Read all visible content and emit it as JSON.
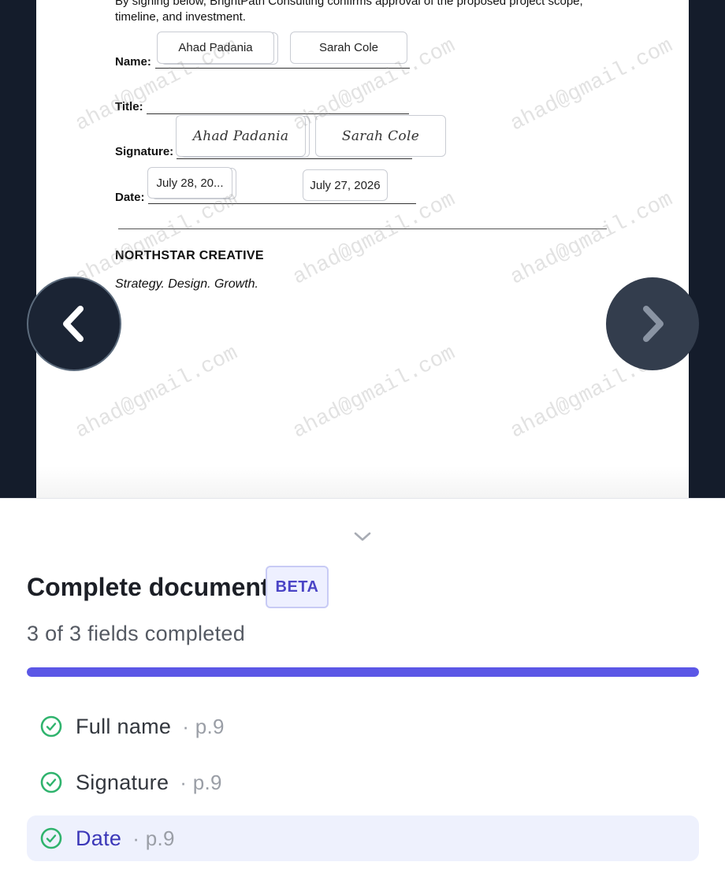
{
  "document": {
    "intro_line1": "By signing below, BrightPath Consulting confirms approval of the proposed project scope,",
    "intro_line2": "timeline, and investment.",
    "labels": {
      "name": "Name:",
      "title": "Title:",
      "signature": "Signature:",
      "date": "Date:"
    },
    "fields": {
      "name_1": "Ahad Padania",
      "name_2": "Sarah Cole",
      "signature_1": "Ahad Padania",
      "signature_2": "Sarah Cole",
      "date_1": "July 28, 20...",
      "date_2": "July 27, 2026"
    },
    "company": "NORTHSTAR CREATIVE",
    "tagline": "Strategy. Design. Growth.",
    "watermark": "ahad@gmail.com"
  },
  "navigation": {
    "prev_icon": "chevron-left-icon",
    "next_icon": "chevron-right-icon"
  },
  "panel": {
    "title": "Complete document",
    "badge": "BETA",
    "progress_text": "3 of 3 fields completed",
    "progress_fraction": 1.0,
    "items": [
      {
        "label": "Full name",
        "page": "· p.9",
        "status": "complete"
      },
      {
        "label": "Signature",
        "page": "· p.9",
        "status": "complete"
      },
      {
        "label": "Date",
        "page": "· p.9",
        "status": "complete",
        "active": true
      }
    ]
  },
  "colors": {
    "accent": "#5b57e6",
    "check_green": "#2fb36d",
    "viewer_bg": "#141c2b"
  }
}
